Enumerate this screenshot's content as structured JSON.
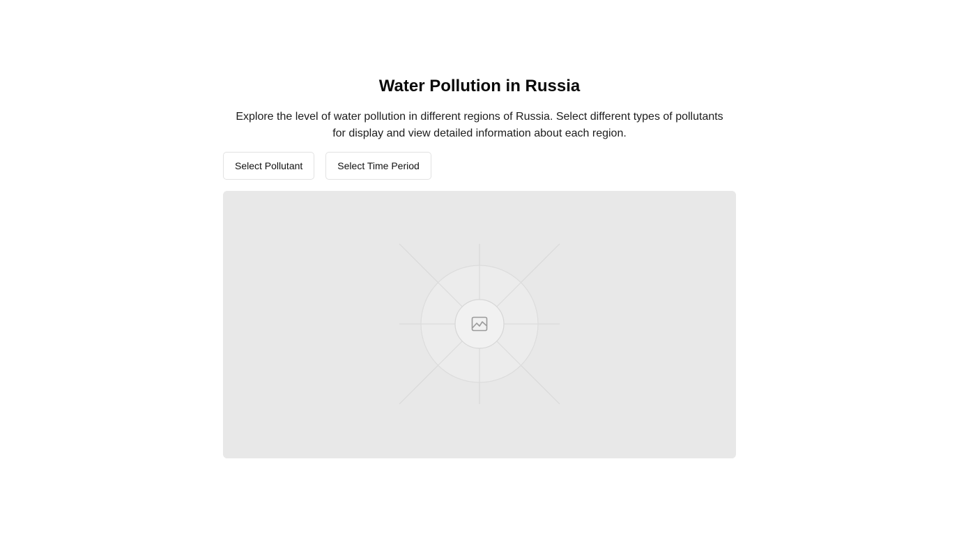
{
  "header": {
    "title": "Water Pollution in Russia",
    "description": "Explore the level of water pollution in different regions of Russia. Select different types of pollutants for display and view detailed information about each region."
  },
  "controls": {
    "pollutant_label": "Select Pollutant",
    "time_period_label": "Select Time Period"
  },
  "map": {
    "placeholder_icon": "image-icon",
    "background_color": "#e8e8e8"
  }
}
